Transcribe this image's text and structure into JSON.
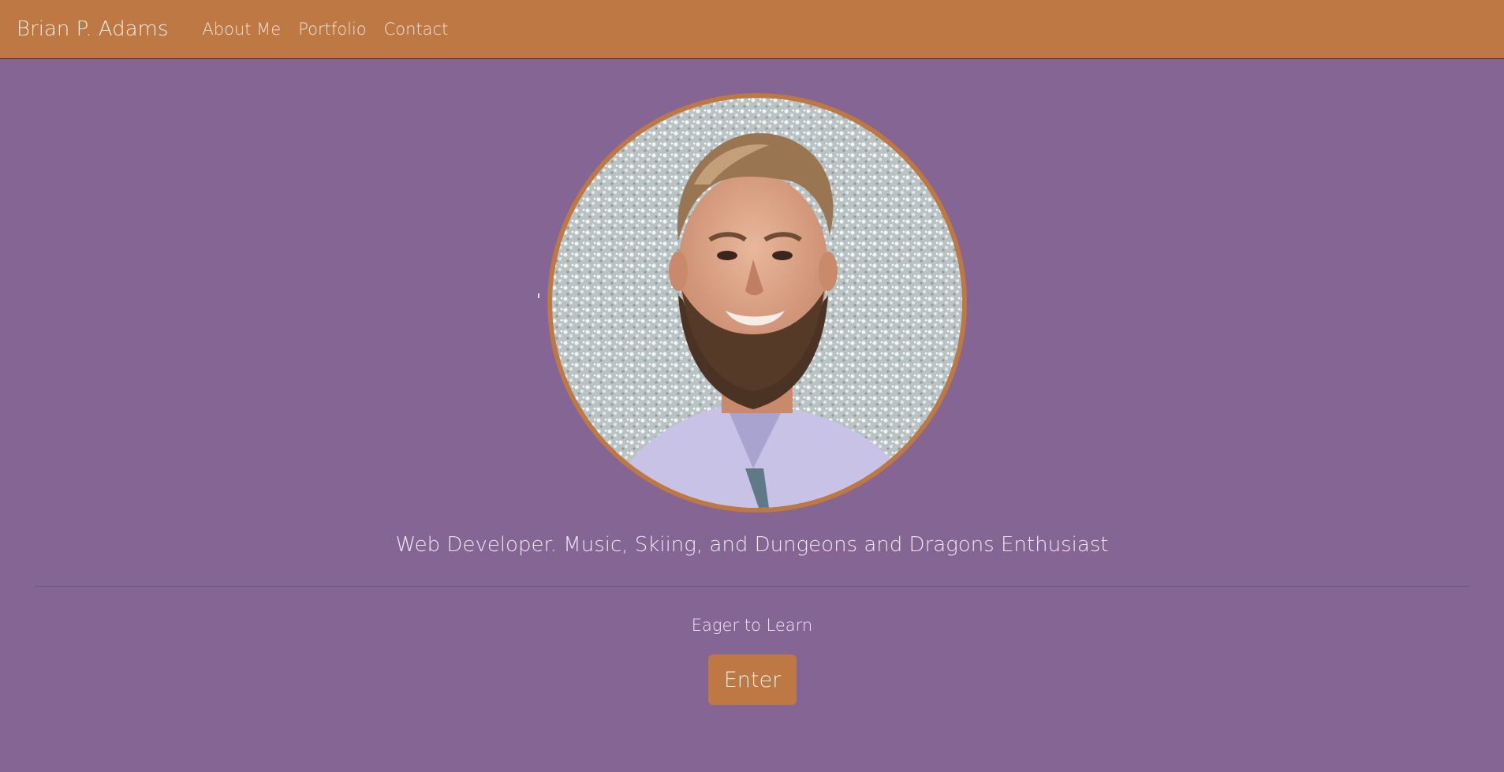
{
  "navbar": {
    "brand": "Brian P. Adams",
    "links": [
      {
        "label": "About Me"
      },
      {
        "label": "Portfolio"
      },
      {
        "label": "Contact"
      }
    ]
  },
  "hero": {
    "avatar_icon": "profile-photo",
    "tagline": "Web Developer. Music, Skiing, and Dungeons and Dragons Enthusiast",
    "subtext": "Eager to Learn",
    "enter_label": "Enter"
  },
  "colors": {
    "background": "#856594",
    "accent": "#bd7843",
    "text": "#f0e8f3"
  }
}
